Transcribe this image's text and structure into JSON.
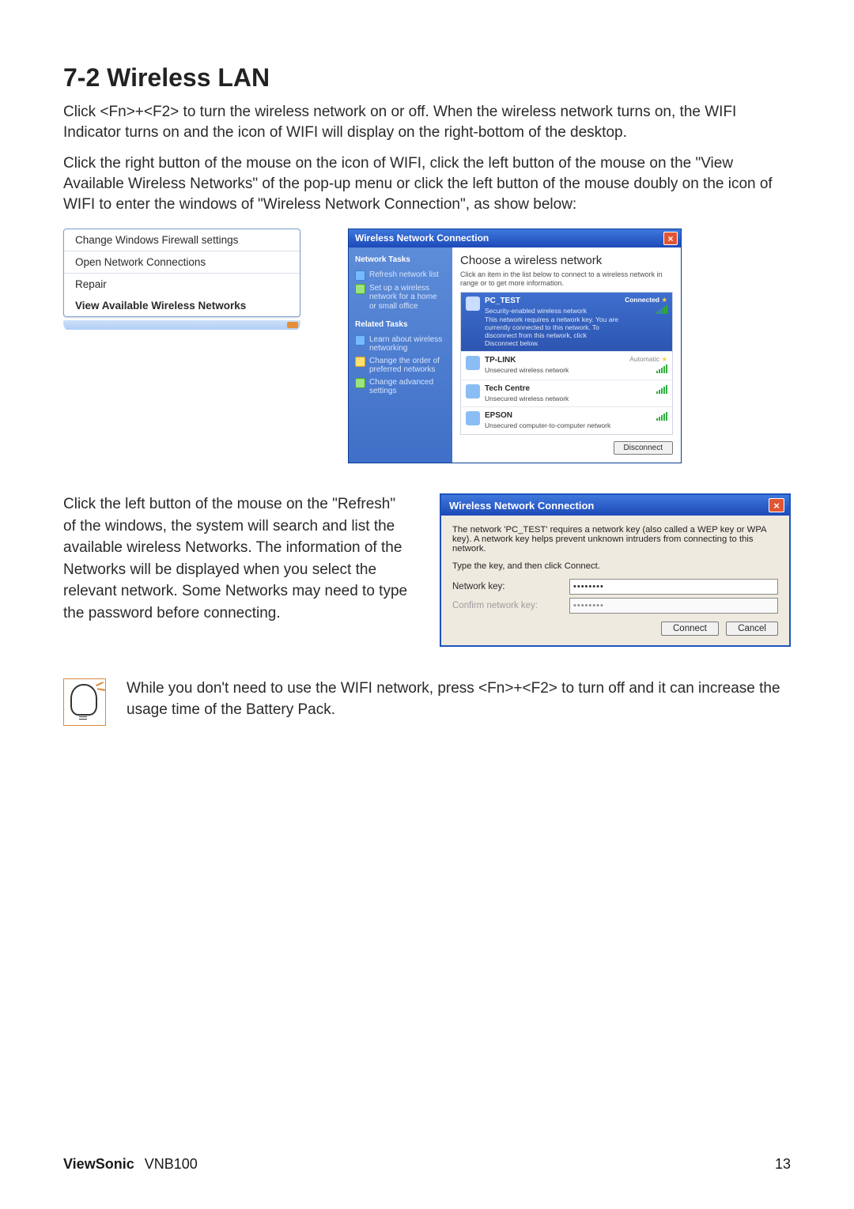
{
  "section": {
    "title": "7-2 Wireless LAN"
  },
  "para1": "Click <Fn>+<F2> to turn the wireless network on or off. When the wireless network turns on, the WIFI Indicator turns on and the icon of WIFI will display on the right-bottom of the desktop.",
  "para2": "Click the right button of the mouse on the icon of WIFI, click the left button of the mouse on the \"View Available Wireless Networks\" of the pop-up menu or click the left button of the mouse doubly on the icon of WIFI to enter the windows of \"Wireless Network Connection\", as show below:",
  "context_menu": {
    "items": [
      "Change Windows Firewall settings",
      "Open Network Connections",
      "Repair",
      "View Available Wireless Networks"
    ]
  },
  "chooser": {
    "title": "Wireless Network Connection",
    "side_heading1": "Network Tasks",
    "side_links1": [
      "Refresh network list",
      "Set up a wireless network for a home or small office"
    ],
    "side_heading2": "Related Tasks",
    "side_links2": [
      "Learn about wireless networking",
      "Change the order of preferred networks",
      "Change advanced settings"
    ],
    "main_heading": "Choose a wireless network",
    "main_instr": "Click an item in the list below to connect to a wireless network in range or to get more information.",
    "networks": [
      {
        "name": "PC_TEST",
        "desc": "Security-enabled wireless network",
        "note": "This network requires a network key. You are currently connected to this network. To disconnect from this network, click Disconnect below.",
        "status": "Connected",
        "star": "★",
        "selected": true
      },
      {
        "name": "TP-LINK",
        "desc": "Unsecured wireless network",
        "status": "Automatic",
        "star": "★"
      },
      {
        "name": "Tech Centre",
        "desc": "Unsecured wireless network"
      },
      {
        "name": "EPSON",
        "desc": "Unsecured computer-to-computer network"
      }
    ],
    "disconnect": "Disconnect"
  },
  "para3": "Click the left button of the mouse on the \"Refresh\" of the windows, the system will search and list the available wireless Networks. The information of the Networks will be displayed when you select the relevant network. Some Networks may need to type the password before connecting.",
  "keydlg": {
    "title": "Wireless Network Connection",
    "msg": "The network 'PC_TEST' requires a network key (also called a WEP key or WPA key). A network key helps prevent unknown intruders from connecting to this network.",
    "instr": "Type the key, and then click Connect.",
    "lbl_key": "Network key:",
    "lbl_confirm": "Confirm network key:",
    "val_key": "••••••••",
    "val_confirm": "••••••••",
    "btn_connect": "Connect",
    "btn_cancel": "Cancel"
  },
  "tip": "While you don't need to use the WIFI network, press <Fn>+<F2> to turn off and it can increase the usage time of the Battery Pack.",
  "footer": {
    "brand": "ViewSonic",
    "model": "VNB100",
    "page": "13"
  }
}
